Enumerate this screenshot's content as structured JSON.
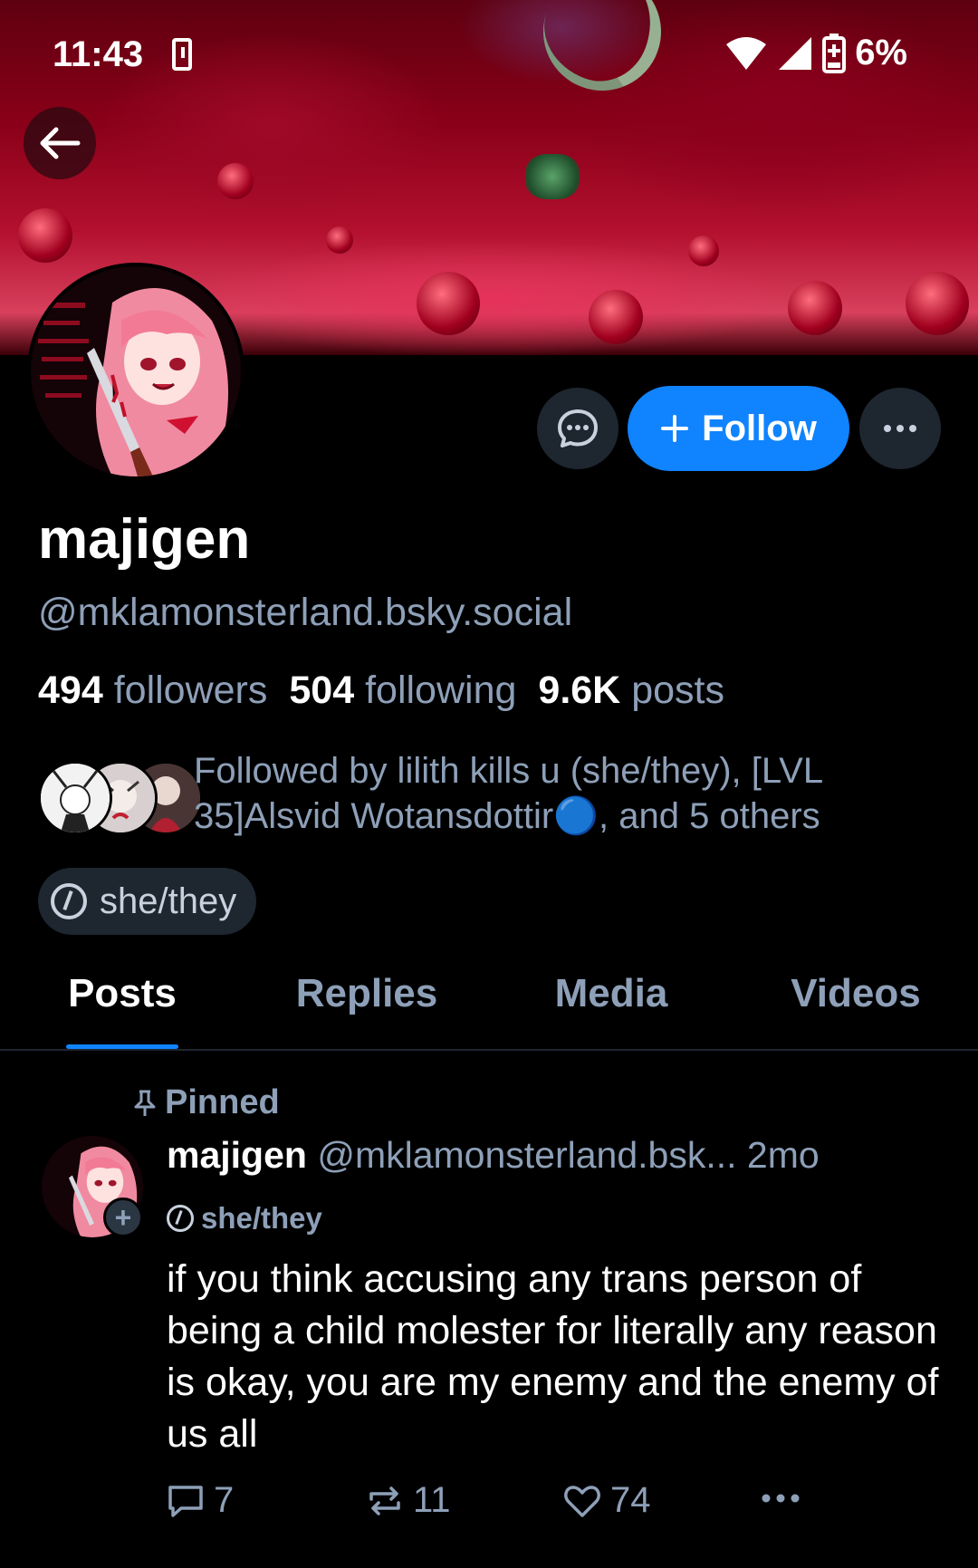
{
  "status_bar": {
    "time": "11:43",
    "battery": "6%"
  },
  "profile": {
    "display_name": "majigen",
    "handle": "@mklamonsterland.bsky.social",
    "followers_count": "494",
    "followers_label": "followers",
    "following_count": "504",
    "following_label": "following",
    "posts_count": "9.6K",
    "posts_label": "posts",
    "followed_by": "Followed by lilith kills u (she/they), [LVL 35]Alsvid Wotansdottir🔵, and 5 others",
    "pronouns": "she/they"
  },
  "actions": {
    "follow_label": "Follow"
  },
  "tabs": [
    {
      "label": "Posts",
      "active": true
    },
    {
      "label": "Replies",
      "active": false
    },
    {
      "label": "Media",
      "active": false
    },
    {
      "label": "Videos",
      "active": false
    }
  ],
  "pinned_post": {
    "pinned_label": "Pinned",
    "author": "majigen",
    "handle": "@mklamonsterland.bsk...",
    "time": "2mo",
    "pronouns": "she/they",
    "text": "if you think accusing any trans person of being a child molester for literally any reason is okay, you are my enemy and the enemy of us all",
    "replies": "7",
    "reposts": "11",
    "likes": "74"
  },
  "colors": {
    "accent": "#1083fe",
    "muted": "#8ea0b8",
    "chip": "#1e2630",
    "background": "#000000"
  },
  "icons": [
    "arrow-left-icon",
    "message-icon",
    "plus-icon",
    "ellipsis-icon",
    "pronoun-icon",
    "pin-icon",
    "reply-icon",
    "repost-icon",
    "heart-icon"
  ]
}
